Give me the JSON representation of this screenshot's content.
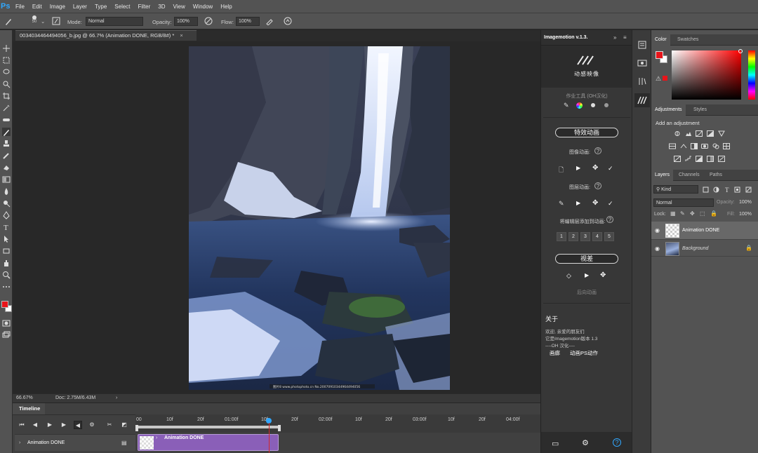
{
  "app": {
    "logo": "Ps"
  },
  "menu": [
    "File",
    "Edit",
    "Image",
    "Layer",
    "Type",
    "Select",
    "Filter",
    "3D",
    "View",
    "Window",
    "Help"
  ],
  "options": {
    "brush_size": "50",
    "mode_label": "Mode:",
    "mode_value": "Normal",
    "opacity_label": "Opacity:",
    "opacity_value": "100%",
    "flow_label": "Flow:",
    "flow_value": "100%"
  },
  "document": {
    "tab_title": "0034034464494056_b.jpg @ 66.7% (Animation DONE, RGB/8#) *",
    "close_glyph": "×",
    "watermark": "图片8 www.photophoto.cn No.20070910344964494056"
  },
  "status": {
    "zoom": "66.67%",
    "doc_size": "Doc: 2.75M/6.43M",
    "arrow": "›"
  },
  "timeline": {
    "tab": "Timeline",
    "ticks": [
      "00",
      "10f",
      "20f",
      "01:00f",
      "10f",
      "20f",
      "02:00f",
      "10f",
      "20f",
      "03:00f",
      "10f",
      "20f",
      "04:00f"
    ],
    "track_name": "Animation DONE",
    "clip_label": "Animation DONE"
  },
  "imagemotion": {
    "title": "Imagemotion v.1.3.",
    "logo_text": "动感映像",
    "tools_label": "作业工具 (OH汉化)",
    "special_effects": "特效动画",
    "image_anim_label": "图像动画:",
    "layer_anim_label": "图层动画:",
    "edit_anim_label": "将编辑层添加到动画:",
    "numbers": [
      "1",
      "2",
      "3",
      "4",
      "5"
    ],
    "parallax": "视差",
    "reverse_anim": "后向动画",
    "about_title": "关于",
    "about_lines": [
      "欢迎, 亲爱的朋友们",
      "它是Imagemotion版本 1.3",
      "----OH 汉化----"
    ],
    "link_1": "画廊",
    "link_2": "动画PS动作"
  },
  "panels": {
    "color_tab": "Color",
    "swatches_tab": "Swatches",
    "adjustments_tab": "Adjustments",
    "styles_tab": "Styles",
    "add_adjustment": "Add an adjustment",
    "layers_tab": "Layers",
    "channels_tab": "Channels",
    "paths_tab": "Paths",
    "kind_label": "Kind",
    "blend_mode": "Normal",
    "opacity_label": "Opacity:",
    "opacity_value": "100%",
    "lock_label": "Lock:",
    "fill_label": "Fill:",
    "fill_value": "100%",
    "layers": [
      {
        "name": "Animation DONE"
      },
      {
        "name": "Background"
      }
    ]
  },
  "colors": {
    "foreground": "#e8141a",
    "background": "#ffffff",
    "clip_purple": "#8a5fb8",
    "accent_blue": "#31a8ff"
  }
}
